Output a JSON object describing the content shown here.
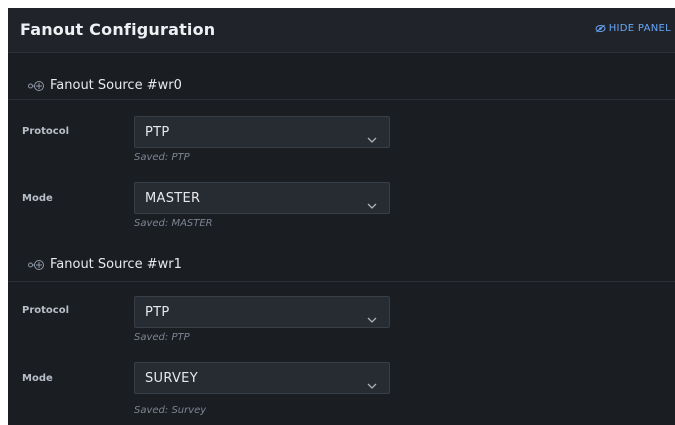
{
  "header": {
    "title": "Fanout Configuration",
    "hide_panel_label": "HIDE PANEL",
    "hide_panel_icon": "eye-slash-icon"
  },
  "sources": [
    {
      "title": "Fanout Source #wr0",
      "icon": "source-link-icon",
      "protocol": {
        "label": "Protocol",
        "value": "PTP",
        "saved": "Saved: PTP"
      },
      "mode": {
        "label": "Mode",
        "value": "MASTER",
        "saved": "Saved: MASTER"
      }
    },
    {
      "title": "Fanout Source #wr1",
      "icon": "source-link-icon",
      "protocol": {
        "label": "Protocol",
        "value": "PTP",
        "saved": "Saved: PTP"
      },
      "mode": {
        "label": "Mode",
        "value": "SURVEY",
        "saved": "Saved: Survey"
      }
    }
  ],
  "colors": {
    "panel_bg": "#1a1d22",
    "header_bg": "#20242a",
    "accent": "#66a6f7",
    "select_bg": "#272c33"
  }
}
